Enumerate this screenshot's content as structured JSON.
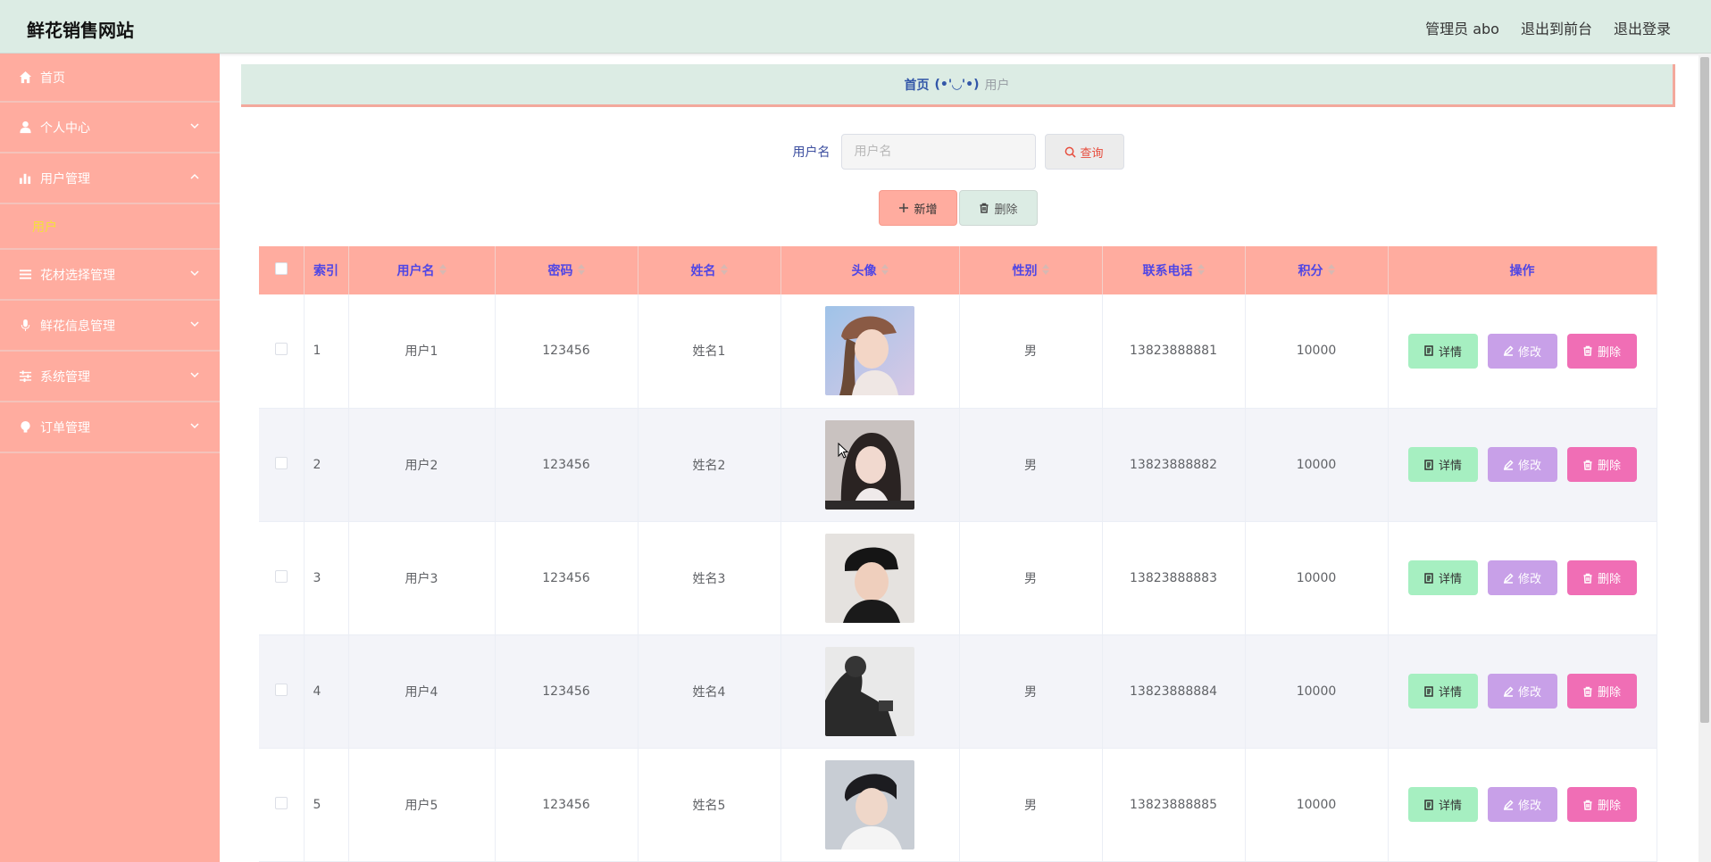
{
  "header": {
    "brand": "鲜花销售网站",
    "role_user": "管理员 abo",
    "to_front": "退出到前台",
    "logout": "退出登录"
  },
  "sidebar": {
    "items": [
      {
        "label": "首页",
        "icon": "home-icon"
      },
      {
        "label": "个人中心",
        "icon": "user-icon"
      },
      {
        "label": "用户管理",
        "icon": "chart-icon"
      },
      {
        "label": "用户",
        "icon": ""
      },
      {
        "label": "花材选择管理",
        "icon": "list-icon"
      },
      {
        "label": "鲜花信息管理",
        "icon": "mic-icon"
      },
      {
        "label": "系统管理",
        "icon": "sliders-icon"
      },
      {
        "label": "订单管理",
        "icon": "bulb-icon"
      }
    ]
  },
  "breadcrumb": {
    "home": "首页",
    "face": "(•'◡'•)",
    "current": "用户"
  },
  "search": {
    "label": "用户名",
    "placeholder": "用户名",
    "query_label": "查询"
  },
  "actions": {
    "add_label": "新增",
    "delete_label": "删除"
  },
  "table": {
    "columns": [
      "索引",
      "用户名",
      "密码",
      "姓名",
      "头像",
      "性别",
      "联系电话",
      "积分",
      "操作"
    ],
    "rows": [
      {
        "index": "1",
        "username": "用户1",
        "password": "123456",
        "name": "姓名1",
        "gender": "男",
        "phone": "13823888881",
        "points": "10000"
      },
      {
        "index": "2",
        "username": "用户2",
        "password": "123456",
        "name": "姓名2",
        "gender": "男",
        "phone": "13823888882",
        "points": "10000"
      },
      {
        "index": "3",
        "username": "用户3",
        "password": "123456",
        "name": "姓名3",
        "gender": "男",
        "phone": "13823888883",
        "points": "10000"
      },
      {
        "index": "4",
        "username": "用户4",
        "password": "123456",
        "name": "姓名4",
        "gender": "男",
        "phone": "13823888884",
        "points": "10000"
      },
      {
        "index": "5",
        "username": "用户5",
        "password": "123456",
        "name": "姓名5",
        "gender": "男",
        "phone": "13823888885",
        "points": "10000"
      }
    ],
    "op_detail": "详情",
    "op_edit": "修改",
    "op_delete": "删除"
  },
  "colors": {
    "accent": "#ffac9f",
    "header_bg": "#dcece4",
    "submenu_active": "#f5e03c",
    "column_header_text": "#4f46e5"
  }
}
